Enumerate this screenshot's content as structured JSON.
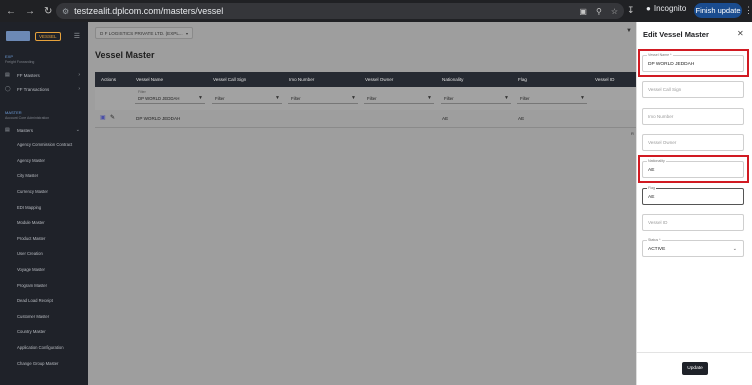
{
  "browser": {
    "url": "testzealit.dplcom.com/masters/vessel",
    "incognito_label": "Incognito",
    "finish_update_label": "Finish update"
  },
  "sidebar": {
    "vessel_tag": "VESSEL",
    "section1_title": "EXP",
    "section1_sub": "Freight Forwarding",
    "groups": [
      {
        "label": "FF Masters"
      },
      {
        "label": "FF Transactions"
      }
    ],
    "section2_title": "MASTER",
    "section2_sub": "Account Core Administration",
    "masters_label": "Masters",
    "items": [
      "Agency Commission Contract",
      "Agency Master",
      "City Master",
      "Currency Master",
      "EDI Mapping",
      "Module Master",
      "Product Master",
      "User Creation",
      "Voyage Master",
      "Program Master",
      "Dead Load Receipt",
      "Customer Master",
      "Country Master",
      "Application Configuration",
      "Change Group Master"
    ]
  },
  "main": {
    "company_select": "D F LOGISTICS PRIVATE LTD. (EXPL...",
    "page_title": "Vessel Master",
    "columns": [
      "Actions",
      "Vessel Name",
      "Vessel Call Sign",
      "Imo Number",
      "Vessel Owner",
      "Nationality",
      "Flag",
      "Vessel ID"
    ],
    "filters": [
      {
        "label": "Filter",
        "value": "DP WORLD JEDDAH"
      },
      {
        "label": "",
        "value": "Filter"
      },
      {
        "label": "",
        "value": "Filter"
      },
      {
        "label": "",
        "value": "Filter"
      },
      {
        "label": "",
        "value": "Filter"
      },
      {
        "label": "",
        "value": "Filter"
      }
    ],
    "row": {
      "vessel_name": "DP WORLD JEDDAH",
      "nationality": "AE",
      "flag": "AE"
    },
    "pager": "R"
  },
  "panel": {
    "title": "Edit Vessel Master",
    "vessel_name_label": "Vessel Name *",
    "vessel_name_value": "DP WORLD JEDDAH",
    "call_sign_placeholder": "Vessel Call Sign",
    "imo_placeholder": "Imo Number",
    "owner_placeholder": "Vessel Owner",
    "nationality_label": "Nationality",
    "nationality_value": "AE",
    "flag_label": "Flag",
    "flag_value": "AE",
    "vessel_id_placeholder": "Vessel ID",
    "status_label": "Status *",
    "status_value": "ACTIVE",
    "update_label": "Update"
  }
}
